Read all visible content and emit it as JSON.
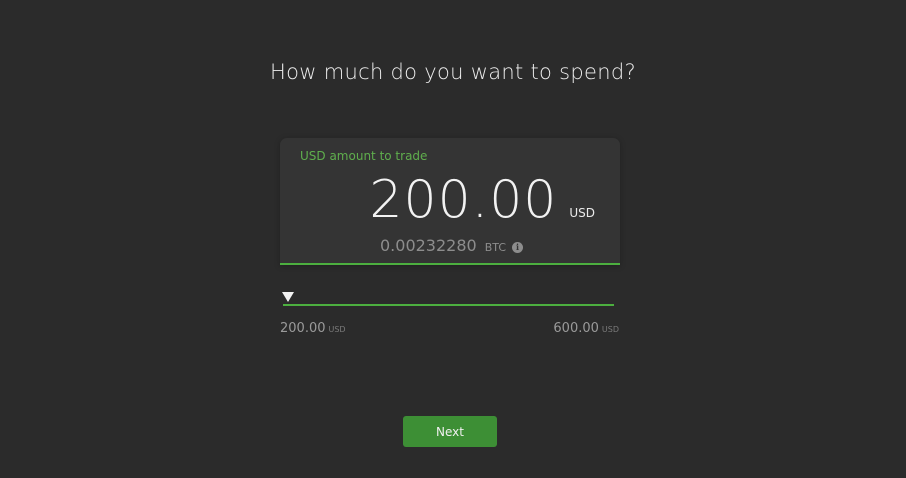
{
  "prompt": {
    "question": "How much do you want to spend?"
  },
  "amount_field": {
    "label": "USD amount to trade",
    "value": "200.00",
    "unit": "USD",
    "conversion_value": "0.00232280",
    "conversion_unit": "BTC",
    "info_icon": "info-icon"
  },
  "slider": {
    "min_value": "200.00",
    "min_unit": "USD",
    "max_value": "600.00",
    "max_unit": "USD",
    "current_fraction": 0.0,
    "handle_icon": "triangle-down-icon"
  },
  "actions": {
    "next_label": "Next"
  },
  "colors": {
    "background": "#2b2b2b",
    "card": "#343434",
    "accent": "#4caf3f",
    "button": "#3d8f35"
  }
}
